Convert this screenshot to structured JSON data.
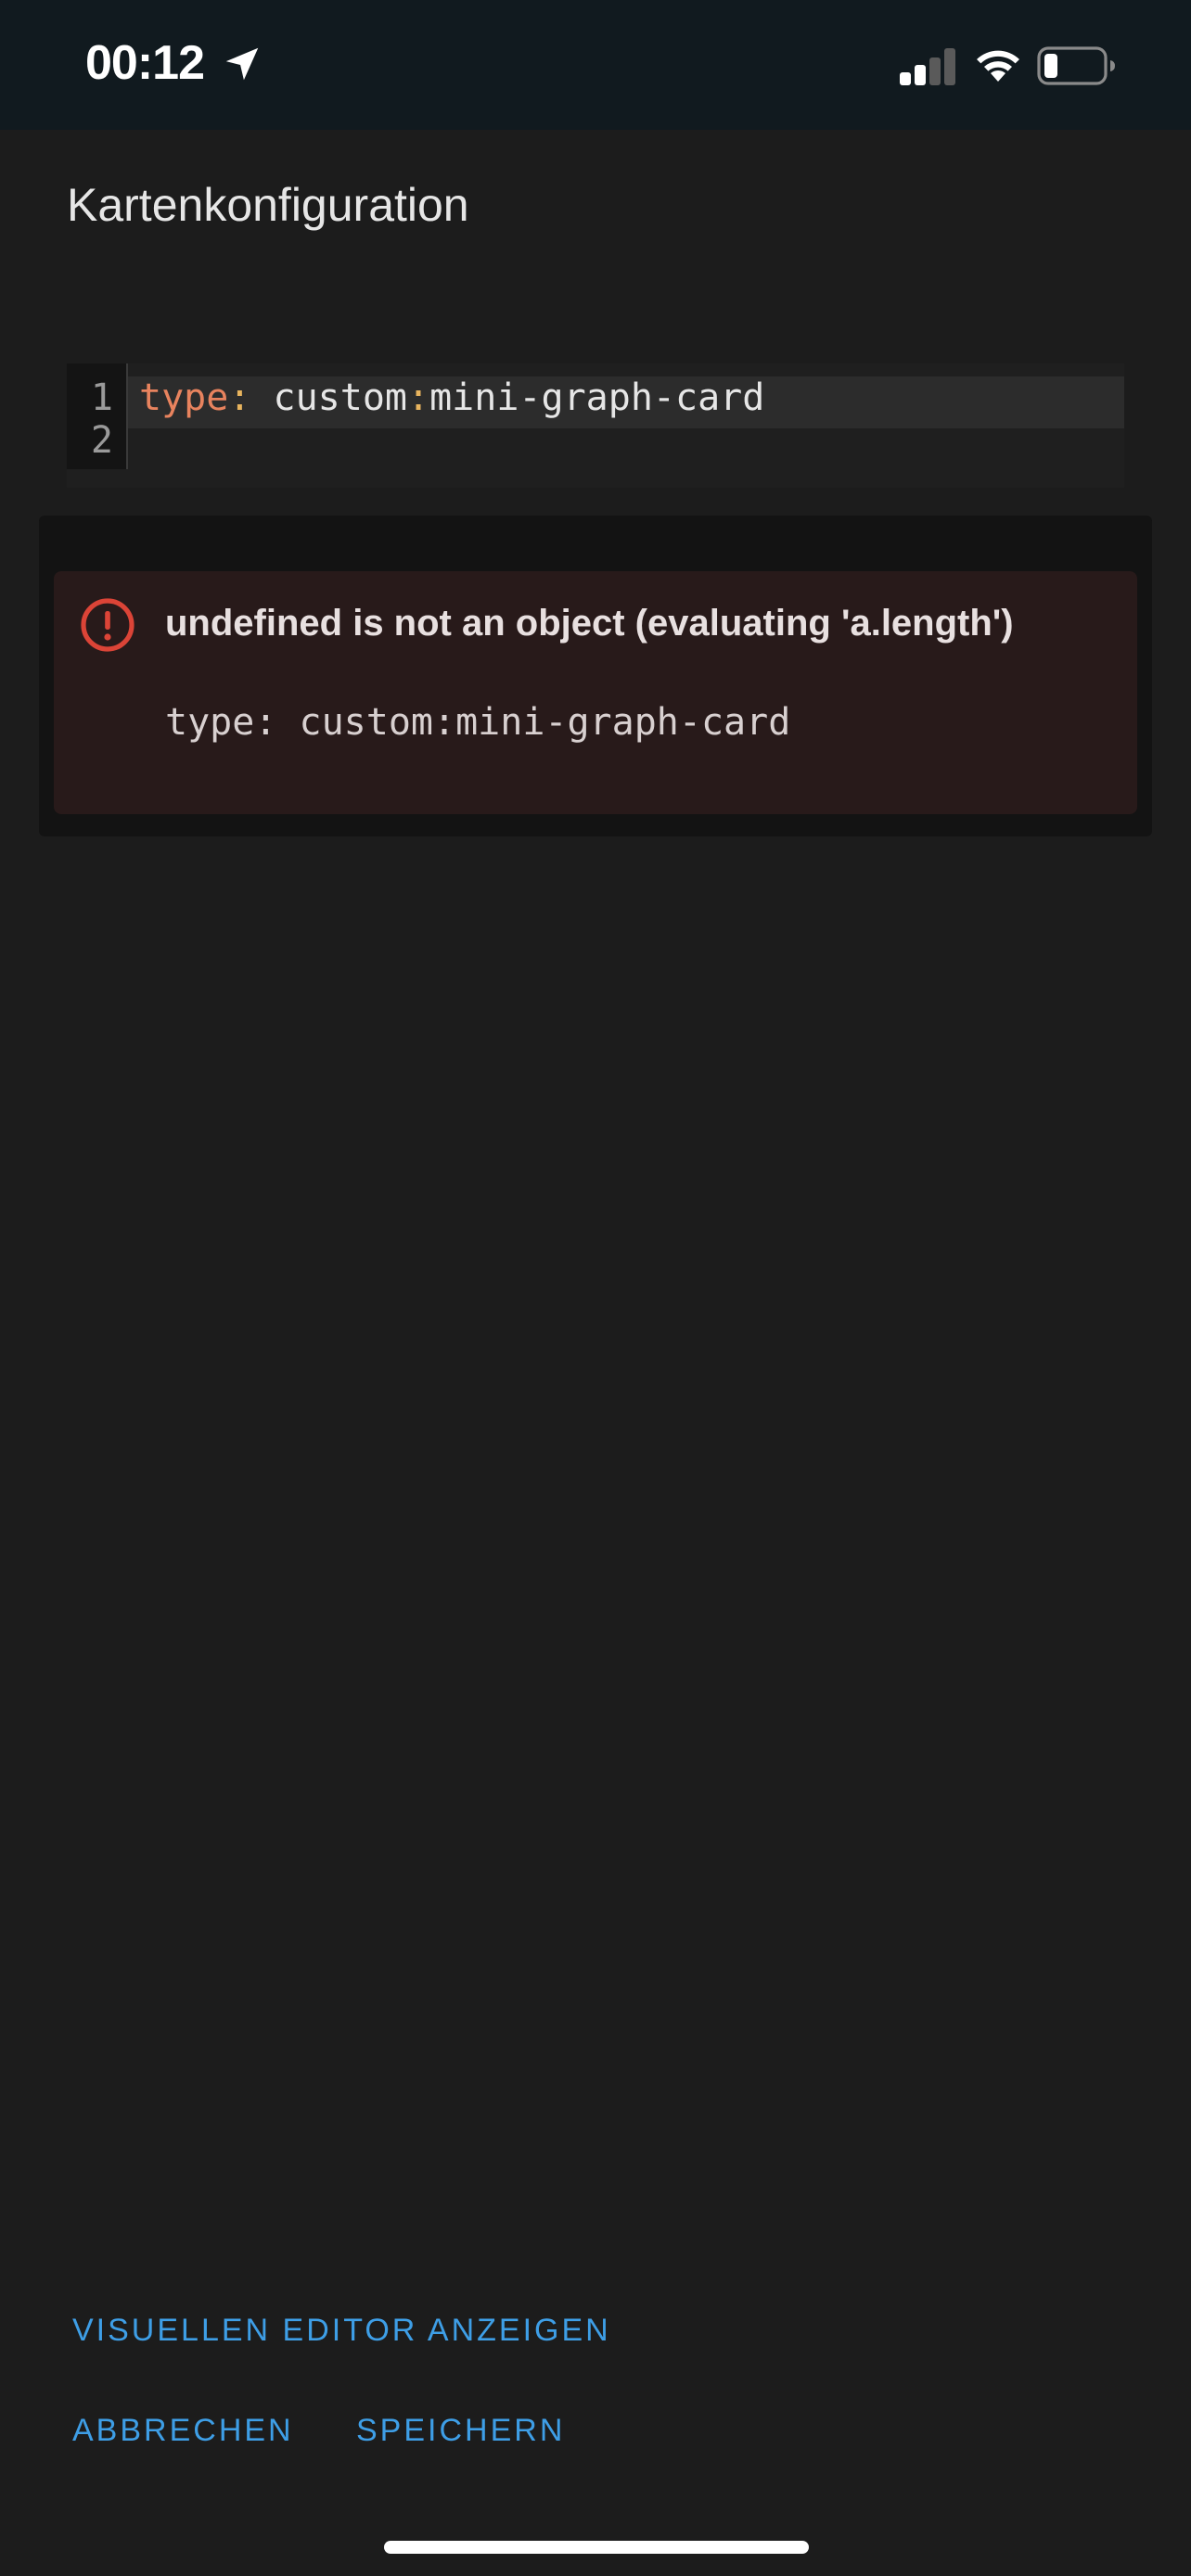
{
  "status_bar": {
    "time": "00:12",
    "icons": [
      "location-arrow-icon",
      "cellular-signal-icon",
      "wifi-icon",
      "battery-icon"
    ]
  },
  "dialog": {
    "title": "Kartenkonfiguration"
  },
  "editor": {
    "line_numbers": [
      "1",
      "2"
    ],
    "line1": {
      "key": "type",
      "colon": ":",
      "value_prefix": " custom",
      "value_colon": ":",
      "value_suffix": "mini-graph-card"
    }
  },
  "error": {
    "icon": "alert-circle-icon",
    "message": "undefined is not an object (evaluating 'a.length')",
    "code": "type: custom:mini-graph-card"
  },
  "actions": {
    "show_visual_editor": "VISUELLEN EDITOR ANZEIGEN",
    "cancel": "ABBRECHEN",
    "save": "SPEICHERN"
  },
  "colors": {
    "accent": "#3e9ee6",
    "error": "#db4437",
    "yaml_key": "#e8835e"
  }
}
